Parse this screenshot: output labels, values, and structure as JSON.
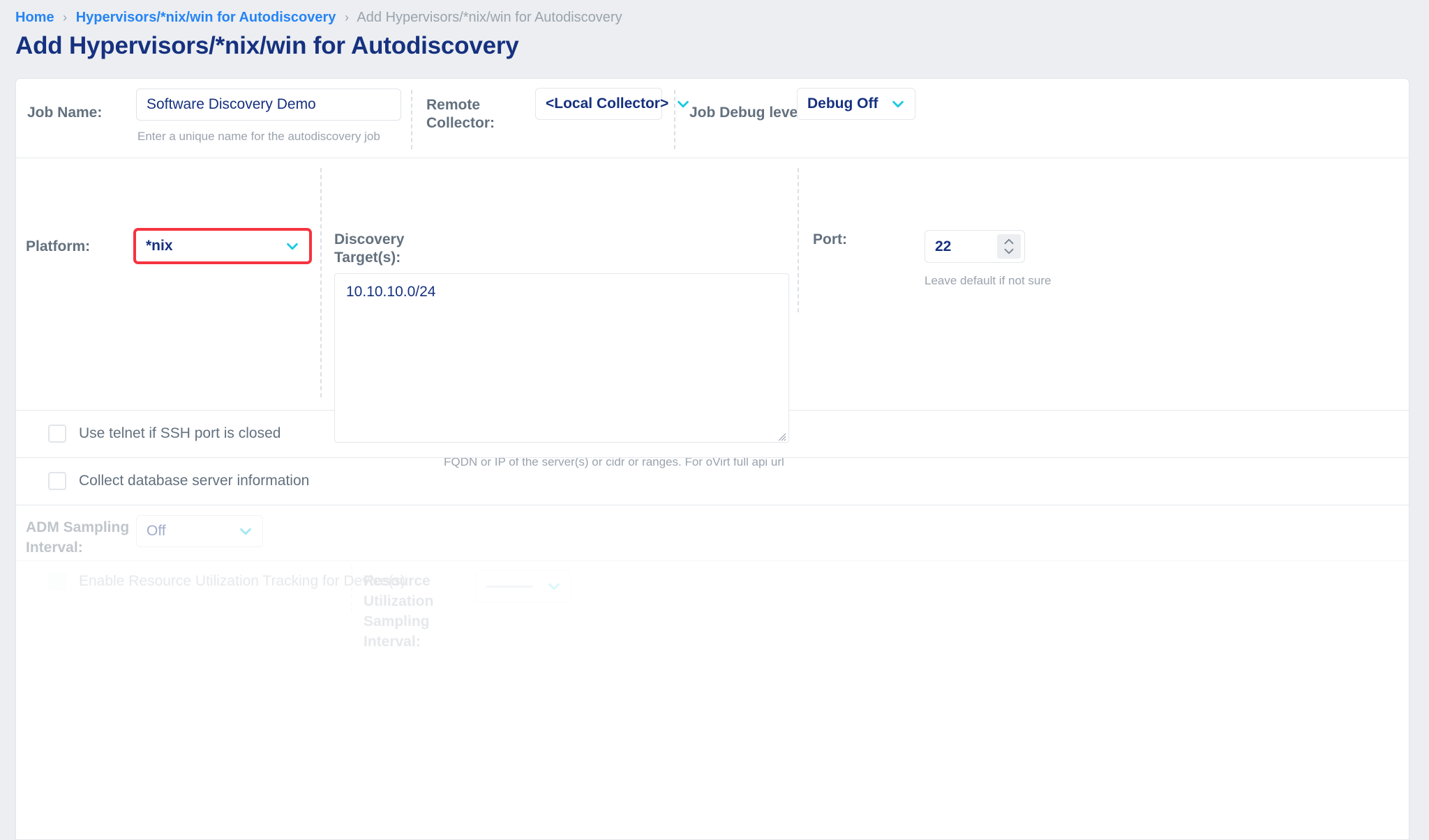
{
  "breadcrumb": {
    "items": [
      {
        "label": "Home",
        "current": false
      },
      {
        "label": "Hypervisors/*nix/win for Autodiscovery",
        "current": false
      },
      {
        "label": "Add Hypervisors/*nix/win for Autodiscovery",
        "current": true
      }
    ],
    "separator": "›"
  },
  "page_title": "Add Hypervisors/*nix/win for Autodiscovery",
  "form": {
    "job_name": {
      "label": "Job Name:",
      "value": "Software Discovery Demo",
      "placeholder": "Job name",
      "helper": "Enter a unique name for the autodiscovery job"
    },
    "remote_collector": {
      "label": "Remote Collector:",
      "value": "<Local Collector>"
    },
    "job_debug_level": {
      "label": "Job Debug level:",
      "value": "Debug Off"
    },
    "platform": {
      "label": "Platform:",
      "value": "*nix",
      "highlight_color": "#f5333f"
    },
    "discovery_targets": {
      "label": "Discovery Target(s):",
      "value": "10.10.10.0/24",
      "placeholder": "",
      "helper": "FQDN or IP of the server(s) or cidr or ranges. For oVirt full api url"
    },
    "port": {
      "label": "Port:",
      "value": "22",
      "helper": "Leave default if not sure"
    },
    "use_telnet": {
      "label": "Use telnet if SSH port is closed",
      "checked": false
    },
    "collect_database": {
      "label": "Collect database server information",
      "checked": false
    },
    "adm_sampling_interval": {
      "label": "ADM Sampling Interval:",
      "value": "Off",
      "disabled": true
    },
    "resource_utilization": {
      "checkbox_label": "Enable Resource Utilization Tracking for Device(s)",
      "checked": false,
      "interval_label": "Resource Utilization Sampling Interval:",
      "interval_value": "",
      "disabled": true
    }
  },
  "colors": {
    "page_bg": "#eceef1",
    "card_bg": "#ffffff",
    "title": "#16317f",
    "link": "#2684f5",
    "muted": "#9aa3ad",
    "label": "#63707e",
    "accent_chevron": "#1fc8e3",
    "highlight_red": "#f5333f"
  }
}
